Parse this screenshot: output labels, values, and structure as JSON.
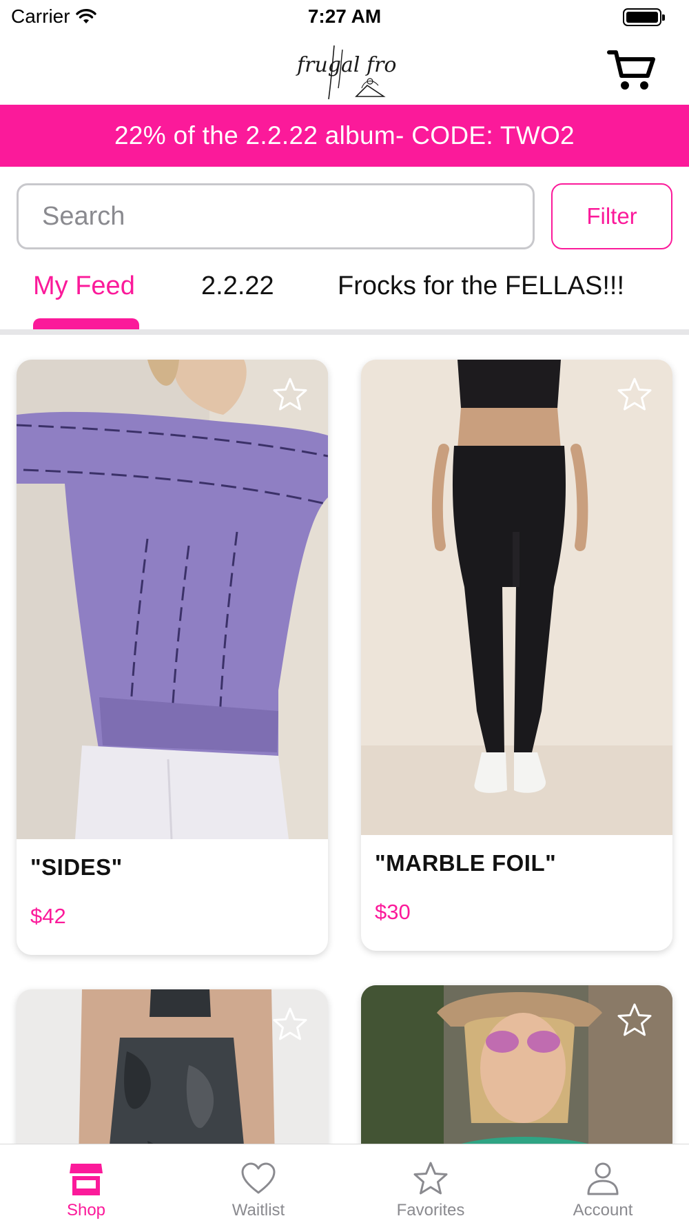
{
  "status_bar": {
    "carrier": "Carrier",
    "time": "7:27 AM"
  },
  "header": {
    "logo": "frugal frocks",
    "logo_icon": "hanger-flower-logo",
    "cart_icon": "cart-icon"
  },
  "promo": {
    "text": "22% of the 2.2.22 album- CODE: TWO2"
  },
  "search": {
    "placeholder": "Search",
    "value": ""
  },
  "filter": {
    "label": "Filter"
  },
  "category_tabs": [
    {
      "label": "My Feed",
      "active": true
    },
    {
      "label": "2.2.22",
      "active": false
    },
    {
      "label": "Frocks for the FELLAS!!!",
      "active": false
    }
  ],
  "products": [
    {
      "name": "\"SIDES\"",
      "price": "$42",
      "favorited": false
    },
    {
      "name": "\"MARBLE FOIL\"",
      "price": "$30",
      "favorited": false
    },
    {
      "name": "",
      "price": "",
      "favorited": false
    },
    {
      "name": "",
      "price": "",
      "favorited": false
    }
  ],
  "bottom_tabs": [
    {
      "label": "Shop",
      "icon": "store-icon",
      "active": true
    },
    {
      "label": "Waitlist",
      "icon": "heart-icon",
      "active": false
    },
    {
      "label": "Favorites",
      "icon": "star-icon",
      "active": false
    },
    {
      "label": "Account",
      "icon": "person-icon",
      "active": false
    }
  ],
  "colors": {
    "accent": "#fb1a9a",
    "inactive": "#8a8a8f",
    "divider": "#e6e6e8"
  }
}
